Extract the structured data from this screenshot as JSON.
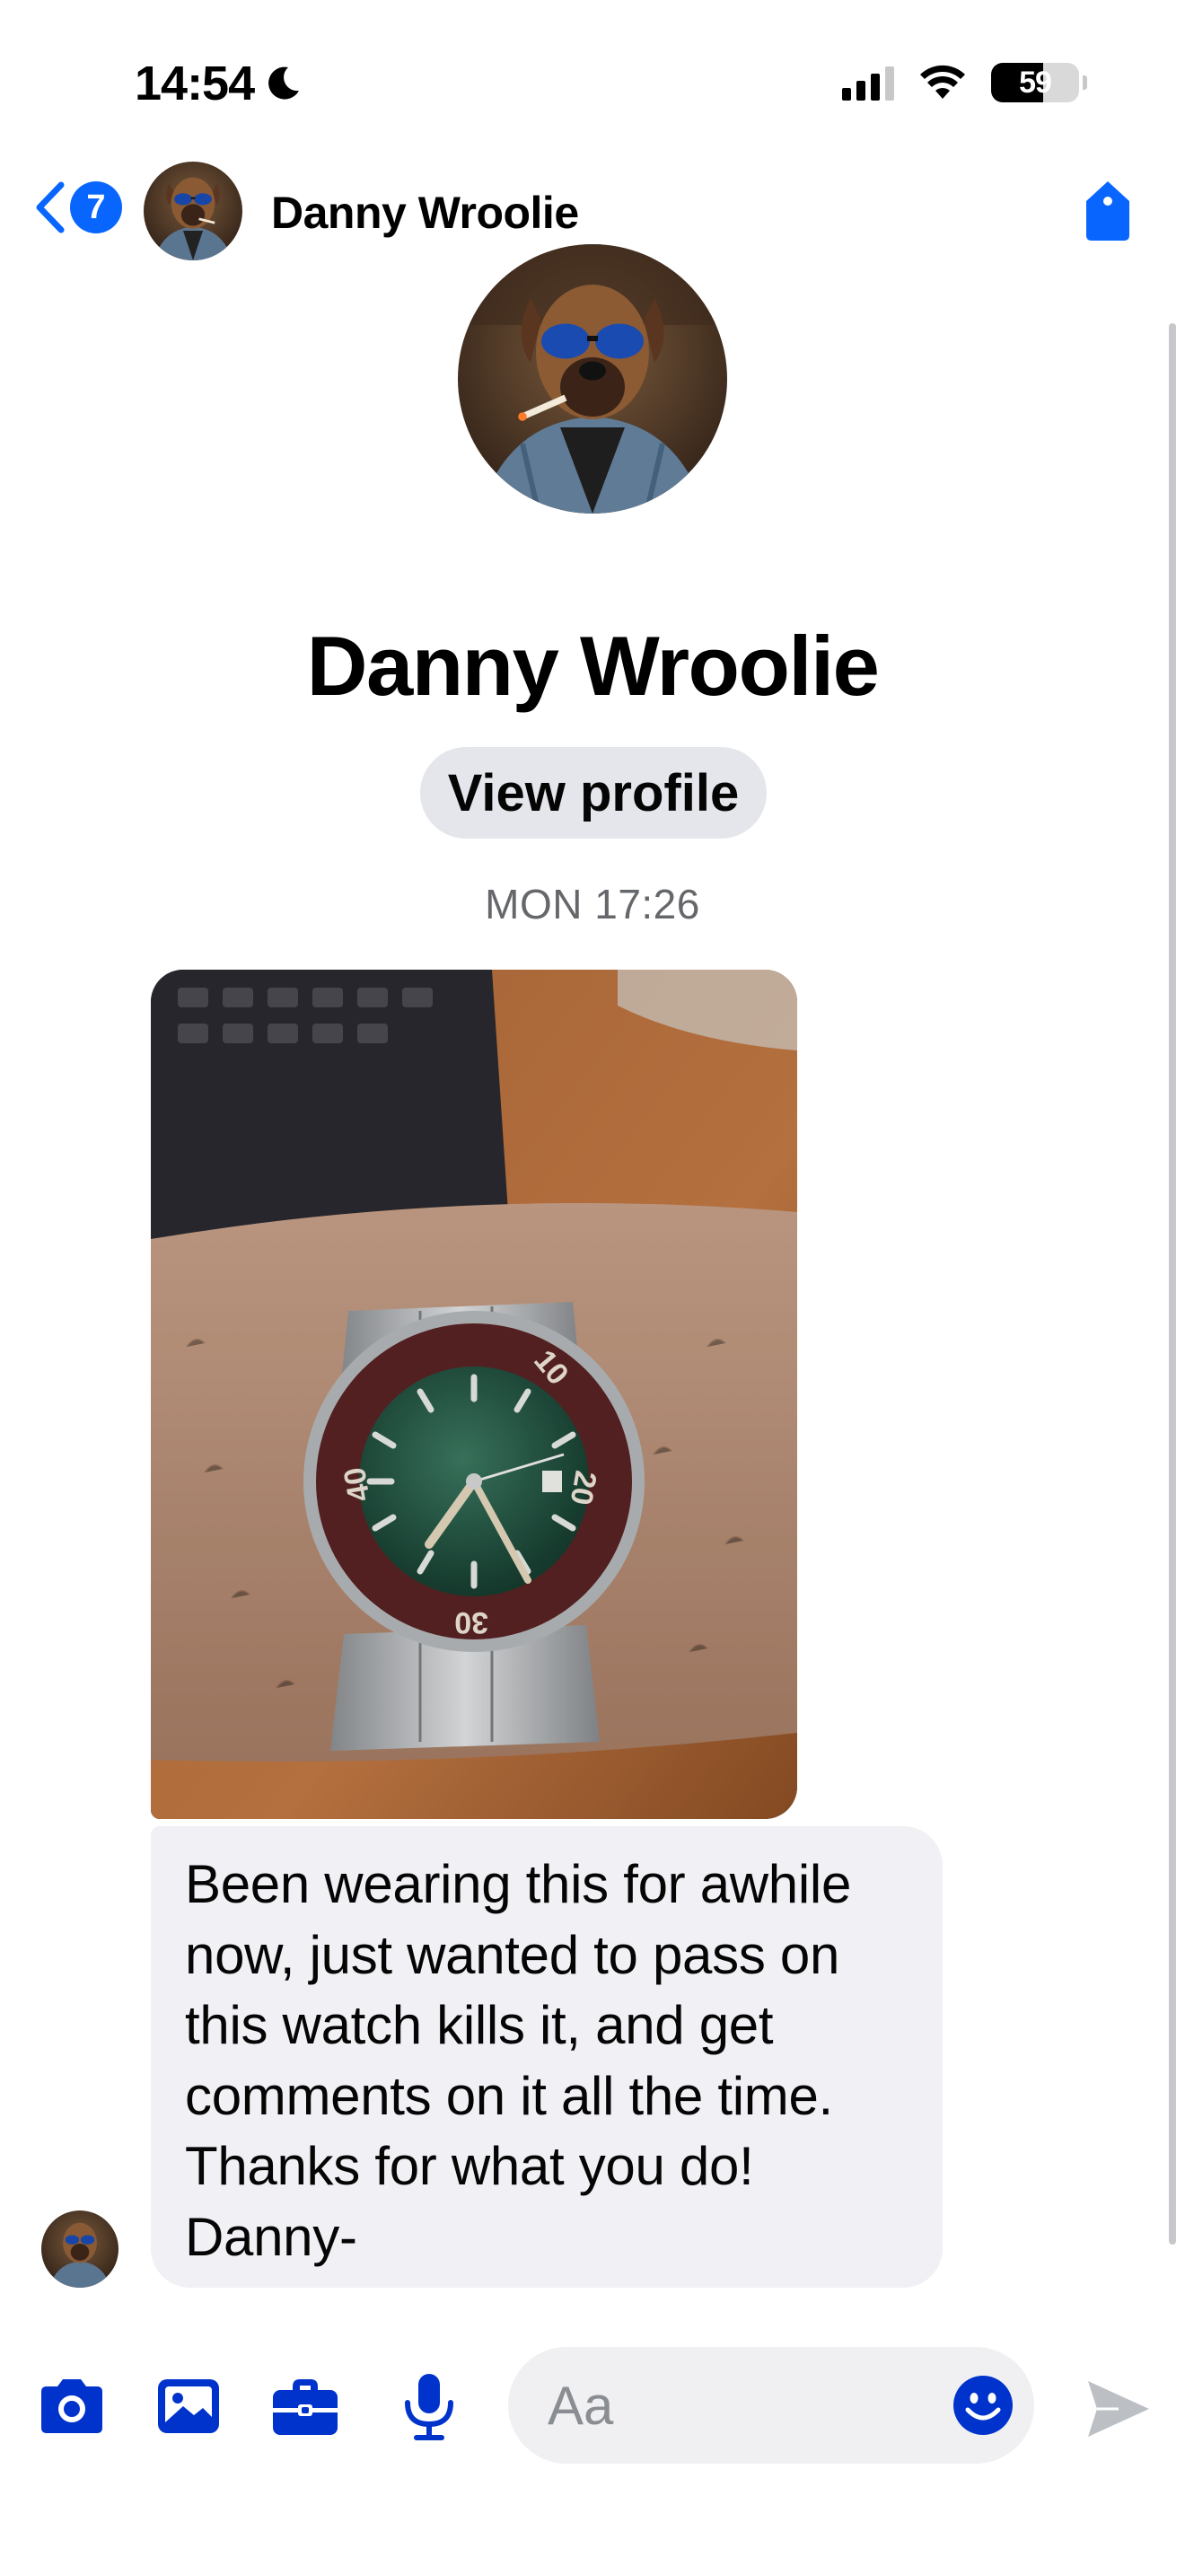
{
  "status_bar": {
    "time": "14:54",
    "battery": "59"
  },
  "nav": {
    "back_badge_count": "7",
    "contact_name": "Danny Wroolie"
  },
  "profile": {
    "name": "Danny Wroolie",
    "view_profile_label": "View profile"
  },
  "conversation": {
    "timestamp": "MON 17:26",
    "messages": [
      {
        "type": "text",
        "lines": [
          "Been wearing this for awhile",
          "now, just wanted to pass on",
          "this watch kills it, and get",
          "comments on it all the time.",
          "Thanks for what you do!",
          "Danny-"
        ]
      }
    ]
  },
  "composer": {
    "placeholder": "Aa",
    "tools": [
      "camera-icon",
      "photo-icon",
      "briefcase-icon",
      "microphone-icon",
      "emoji-icon",
      "send-icon"
    ]
  },
  "colors": {
    "accent": "#0866ff",
    "tool_blue": "#0033cc",
    "bubble": "#f0f0f5",
    "secondary_text": "#65676b"
  }
}
